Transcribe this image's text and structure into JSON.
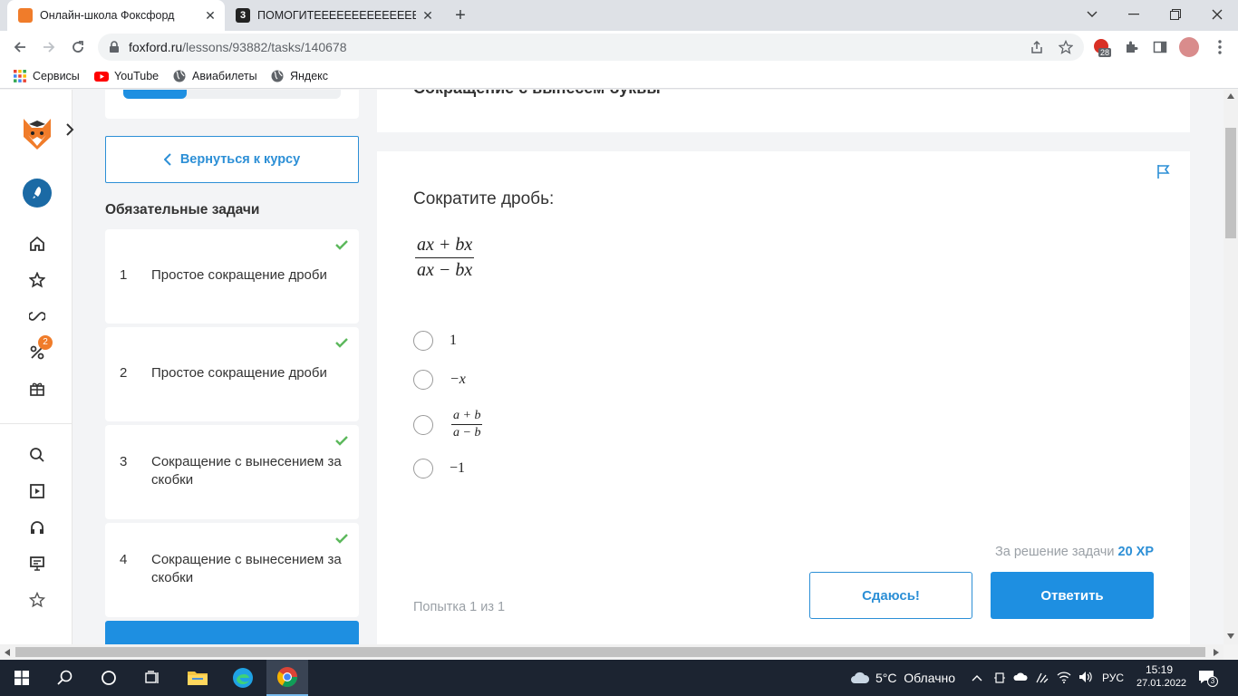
{
  "browser": {
    "tabs": [
      {
        "title": "Онлайн-школа Фоксфорд",
        "active": true
      },
      {
        "title": "ПОМОГИТЕЕЕЕЕЕЕЕЕЕЕЕЕЕЕЕЕЕЕЕЕЕ",
        "active": false
      }
    ],
    "url_host": "foxford.ru",
    "url_path": "/lessons/93882/tasks/140678",
    "extension_badge": "28",
    "bookmarks": [
      "Сервисы",
      "YouTube",
      "Авиабилеты",
      "Яндекс"
    ]
  },
  "leftnav": {
    "discount_badge": "2"
  },
  "sidebar": {
    "back_label": "Вернуться к курсу",
    "section_title": "Обязательные задачи",
    "tasks": [
      {
        "num": "1",
        "label": "Простое сокращение дроби",
        "done": true
      },
      {
        "num": "2",
        "label": "Простое сокращение дроби",
        "done": true
      },
      {
        "num": "3",
        "label": "Сокращение с вынесением за скобки",
        "done": true
      },
      {
        "num": "4",
        "label": "Сокращение с вынесением за скобки",
        "done": true
      }
    ]
  },
  "task": {
    "header_partial": "Сокращение с вынесем буквы",
    "question": "Сократите дробь:",
    "fraction": {
      "numerator": "ax + bx",
      "denominator": "ax − bx"
    },
    "options": [
      {
        "text": "1"
      },
      {
        "text": "−x"
      },
      {
        "numerator": "a + b",
        "denominator": "a − b"
      },
      {
        "text": "−1"
      }
    ],
    "reward_prefix": "За решение задачи",
    "reward_value": "20 XP",
    "attempt": "Попытка 1 из 1",
    "giveup_label": "Сдаюсь!",
    "answer_label": "Ответить"
  },
  "taskbar": {
    "weather": "5°C  Облачно",
    "lang": "РУС",
    "time": "15:19",
    "date": "27.01.2022",
    "notifications": "3"
  },
  "colors": {
    "accent": "#1e8fe1",
    "check": "#5cb85c",
    "badge": "#f07c2a"
  }
}
